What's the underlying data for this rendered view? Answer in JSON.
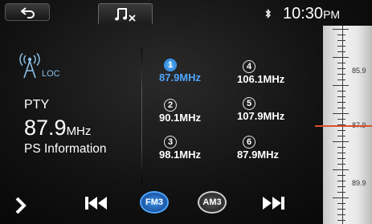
{
  "clock": {
    "time": "10:30",
    "ampm": "PM"
  },
  "station": {
    "loc_label": "LOC",
    "pty_label": "PTY",
    "frequency": "87.9",
    "frequency_unit": "MHz",
    "ps_info": "PS Information"
  },
  "presets": [
    {
      "number": "1",
      "frequency": "87.9MHz",
      "active": true
    },
    {
      "number": "2",
      "frequency": "90.1MHz",
      "active": false
    },
    {
      "number": "3",
      "frequency": "98.1MHz",
      "active": false
    },
    {
      "number": "4",
      "frequency": "106.1MHz",
      "active": false
    },
    {
      "number": "5",
      "frequency": "107.9MHz",
      "active": false
    },
    {
      "number": "6",
      "frequency": "87.9MHz",
      "active": false
    }
  ],
  "tuner_scale": {
    "labels": [
      "85.9",
      "87.9",
      "89.9"
    ],
    "current": "87.9"
  },
  "bands": {
    "fm": "FM3",
    "am": "AM3",
    "selected": "FM3"
  },
  "icons": {
    "back": "back-arrow-icon",
    "music": "music-mute-icon",
    "bluetooth": "bluetooth-icon",
    "antenna": "antenna-icon",
    "next_page": "chevron-right-icon",
    "seek_back": "skip-back-icon",
    "seek_forward": "skip-forward-icon"
  },
  "colors": {
    "accent": "#4fa6ff",
    "needle": "#d8522a",
    "loc": "#8ac0e8"
  }
}
